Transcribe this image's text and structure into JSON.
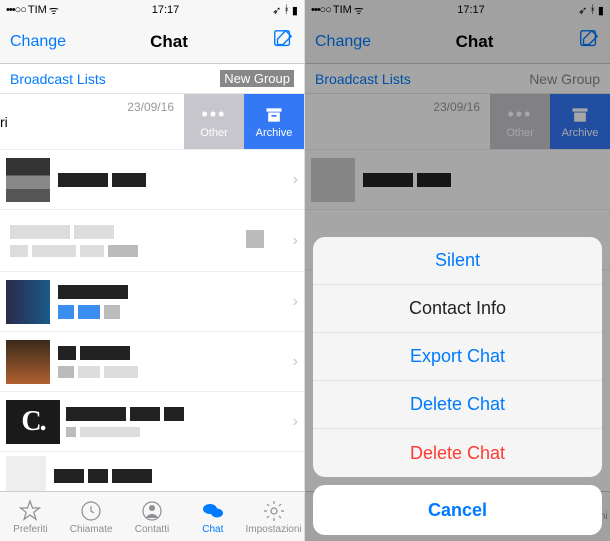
{
  "status": {
    "carrier": "TIM",
    "time": "17:17",
    "signal": "•••○○",
    "icons": "⤒ ⚡"
  },
  "nav": {
    "left": "Change",
    "title": "Chat",
    "compose": "compose"
  },
  "subbar": {
    "left": "Broadcast Lists",
    "right": "New Group"
  },
  "swipe": {
    "other": "Other",
    "archive": "Archive"
  },
  "rows": {
    "first_name_cut": "ri",
    "first_date": "23/09/16"
  },
  "tabs": {
    "fav": "Preferiti",
    "calls": "Chiamate",
    "contacts": "Contatti",
    "chat": "Chat",
    "settings": "Impostazioni"
  },
  "sheet": {
    "silent": "Silent",
    "info": "Contact Info",
    "export": "Export Chat",
    "delete1": "Delete Chat",
    "delete2": "Delete Chat",
    "cancel": "Cancel"
  },
  "right_nav": {
    "left": "Change",
    "title": "Chat"
  },
  "right_subbar": {
    "left": "Broadcast Lists",
    "right": "New Group"
  }
}
